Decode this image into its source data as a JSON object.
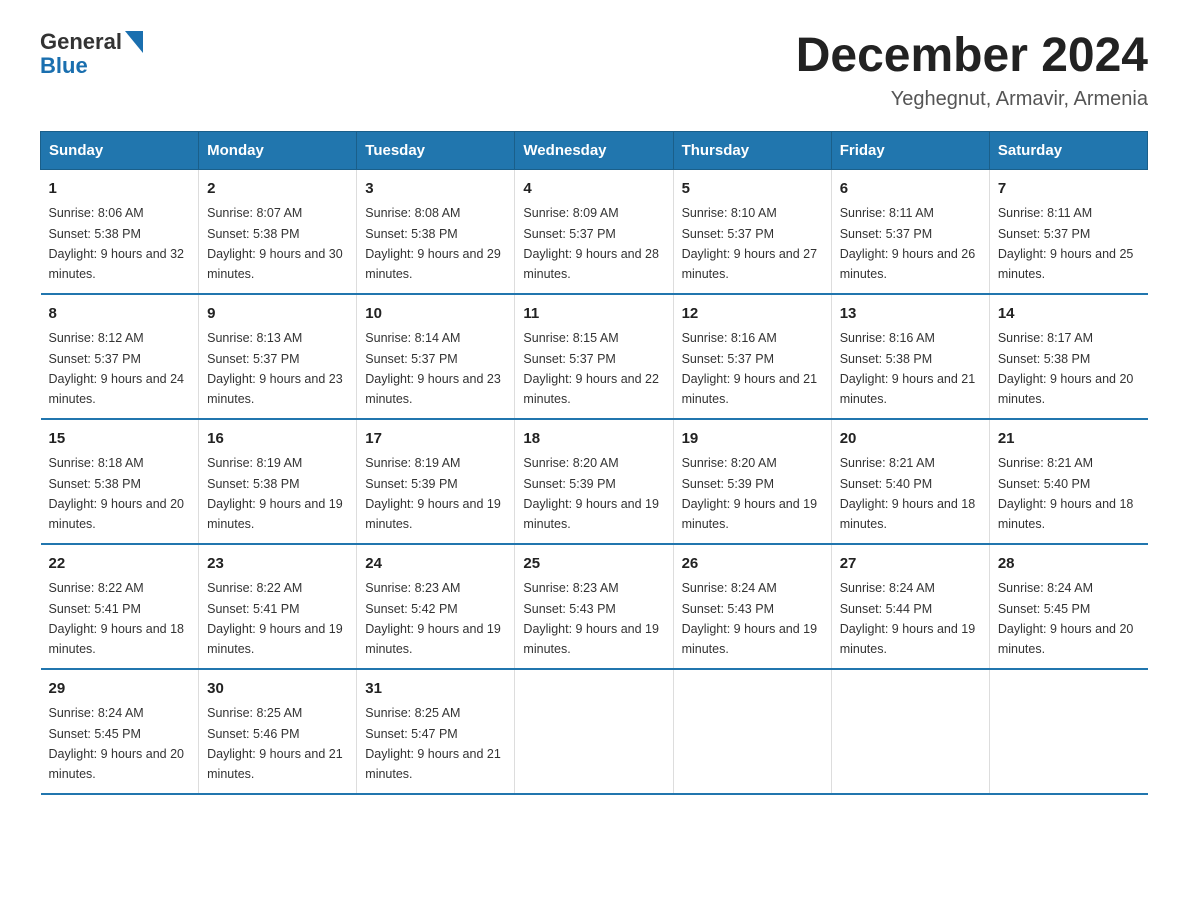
{
  "logo": {
    "general": "General",
    "blue": "Blue"
  },
  "title": "December 2024",
  "location": "Yeghegnut, Armavir, Armenia",
  "headers": [
    "Sunday",
    "Monday",
    "Tuesday",
    "Wednesday",
    "Thursday",
    "Friday",
    "Saturday"
  ],
  "weeks": [
    [
      {
        "day": "1",
        "sunrise": "8:06 AM",
        "sunset": "5:38 PM",
        "daylight": "9 hours and 32 minutes."
      },
      {
        "day": "2",
        "sunrise": "8:07 AM",
        "sunset": "5:38 PM",
        "daylight": "9 hours and 30 minutes."
      },
      {
        "day": "3",
        "sunrise": "8:08 AM",
        "sunset": "5:38 PM",
        "daylight": "9 hours and 29 minutes."
      },
      {
        "day": "4",
        "sunrise": "8:09 AM",
        "sunset": "5:37 PM",
        "daylight": "9 hours and 28 minutes."
      },
      {
        "day": "5",
        "sunrise": "8:10 AM",
        "sunset": "5:37 PM",
        "daylight": "9 hours and 27 minutes."
      },
      {
        "day": "6",
        "sunrise": "8:11 AM",
        "sunset": "5:37 PM",
        "daylight": "9 hours and 26 minutes."
      },
      {
        "day": "7",
        "sunrise": "8:11 AM",
        "sunset": "5:37 PM",
        "daylight": "9 hours and 25 minutes."
      }
    ],
    [
      {
        "day": "8",
        "sunrise": "8:12 AM",
        "sunset": "5:37 PM",
        "daylight": "9 hours and 24 minutes."
      },
      {
        "day": "9",
        "sunrise": "8:13 AM",
        "sunset": "5:37 PM",
        "daylight": "9 hours and 23 minutes."
      },
      {
        "day": "10",
        "sunrise": "8:14 AM",
        "sunset": "5:37 PM",
        "daylight": "9 hours and 23 minutes."
      },
      {
        "day": "11",
        "sunrise": "8:15 AM",
        "sunset": "5:37 PM",
        "daylight": "9 hours and 22 minutes."
      },
      {
        "day": "12",
        "sunrise": "8:16 AM",
        "sunset": "5:37 PM",
        "daylight": "9 hours and 21 minutes."
      },
      {
        "day": "13",
        "sunrise": "8:16 AM",
        "sunset": "5:38 PM",
        "daylight": "9 hours and 21 minutes."
      },
      {
        "day": "14",
        "sunrise": "8:17 AM",
        "sunset": "5:38 PM",
        "daylight": "9 hours and 20 minutes."
      }
    ],
    [
      {
        "day": "15",
        "sunrise": "8:18 AM",
        "sunset": "5:38 PM",
        "daylight": "9 hours and 20 minutes."
      },
      {
        "day": "16",
        "sunrise": "8:19 AM",
        "sunset": "5:38 PM",
        "daylight": "9 hours and 19 minutes."
      },
      {
        "day": "17",
        "sunrise": "8:19 AM",
        "sunset": "5:39 PM",
        "daylight": "9 hours and 19 minutes."
      },
      {
        "day": "18",
        "sunrise": "8:20 AM",
        "sunset": "5:39 PM",
        "daylight": "9 hours and 19 minutes."
      },
      {
        "day": "19",
        "sunrise": "8:20 AM",
        "sunset": "5:39 PM",
        "daylight": "9 hours and 19 minutes."
      },
      {
        "day": "20",
        "sunrise": "8:21 AM",
        "sunset": "5:40 PM",
        "daylight": "9 hours and 18 minutes."
      },
      {
        "day": "21",
        "sunrise": "8:21 AM",
        "sunset": "5:40 PM",
        "daylight": "9 hours and 18 minutes."
      }
    ],
    [
      {
        "day": "22",
        "sunrise": "8:22 AM",
        "sunset": "5:41 PM",
        "daylight": "9 hours and 18 minutes."
      },
      {
        "day": "23",
        "sunrise": "8:22 AM",
        "sunset": "5:41 PM",
        "daylight": "9 hours and 19 minutes."
      },
      {
        "day": "24",
        "sunrise": "8:23 AM",
        "sunset": "5:42 PM",
        "daylight": "9 hours and 19 minutes."
      },
      {
        "day": "25",
        "sunrise": "8:23 AM",
        "sunset": "5:43 PM",
        "daylight": "9 hours and 19 minutes."
      },
      {
        "day": "26",
        "sunrise": "8:24 AM",
        "sunset": "5:43 PM",
        "daylight": "9 hours and 19 minutes."
      },
      {
        "day": "27",
        "sunrise": "8:24 AM",
        "sunset": "5:44 PM",
        "daylight": "9 hours and 19 minutes."
      },
      {
        "day": "28",
        "sunrise": "8:24 AM",
        "sunset": "5:45 PM",
        "daylight": "9 hours and 20 minutes."
      }
    ],
    [
      {
        "day": "29",
        "sunrise": "8:24 AM",
        "sunset": "5:45 PM",
        "daylight": "9 hours and 20 minutes."
      },
      {
        "day": "30",
        "sunrise": "8:25 AM",
        "sunset": "5:46 PM",
        "daylight": "9 hours and 21 minutes."
      },
      {
        "day": "31",
        "sunrise": "8:25 AM",
        "sunset": "5:47 PM",
        "daylight": "9 hours and 21 minutes."
      },
      null,
      null,
      null,
      null
    ]
  ]
}
